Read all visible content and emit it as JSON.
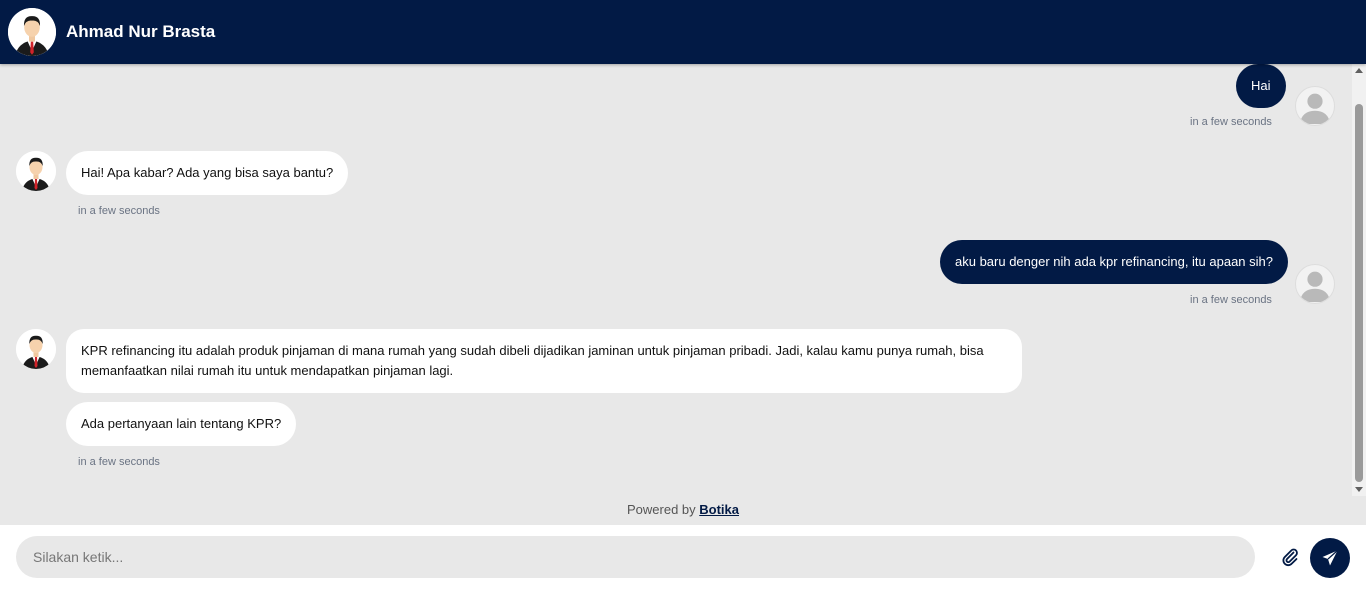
{
  "header": {
    "name": "Ahmad Nur Brasta"
  },
  "messages": [
    {
      "sender": "user",
      "text": "Hai",
      "time": "in a few seconds"
    },
    {
      "sender": "bot",
      "text": "Hai! Apa kabar? Ada yang bisa saya bantu?",
      "time": "in a few seconds"
    },
    {
      "sender": "user",
      "text": "aku baru denger nih ada kpr refinancing, itu apaan sih?",
      "time": "in a few seconds"
    },
    {
      "sender": "bot",
      "text_line1": "KPR refinancing itu adalah produk pinjaman di mana rumah yang sudah dibeli dijadikan jaminan untuk pinjaman pribadi. Jadi, kalau kamu punya rumah, bisa",
      "text_line2": "memanfaatkan nilai rumah itu untuk mendapatkan pinjaman lagi."
    },
    {
      "sender": "bot",
      "text": "Ada pertanyaan lain tentang KPR?",
      "time": "in a few seconds"
    }
  ],
  "footer": {
    "powered_by": "Powered by",
    "brand": "Botika"
  },
  "composer": {
    "placeholder": "Silakan ketik..."
  },
  "colors": {
    "primary": "#021a45",
    "background": "#e8e8e8",
    "bot_bubble": "#ffffff"
  },
  "icons": {
    "attach": "paperclip-icon",
    "send": "paper-plane-icon"
  }
}
